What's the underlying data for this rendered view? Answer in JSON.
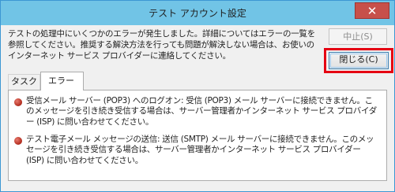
{
  "window": {
    "title": "テスト アカウント設定",
    "close_glyph": "✕"
  },
  "message": "テストの処理中にいくつかのエラーが発生しました。詳細についてはエラーの一覧を参照してください。推奨する解決方法を行っても問題が解決しない場合は、お使いのインターネット サービス プロバイダーに連絡してください。",
  "buttons": {
    "stop_label": "中止(S)",
    "close_label": "閉じる(C)"
  },
  "tabs": [
    {
      "label": "タスク",
      "selected": false
    },
    {
      "label": "エラー",
      "selected": true
    }
  ],
  "errors": [
    {
      "icon": "error-icon",
      "text": "受信メール サーバー (POP3) へのログオン: 受信 (POP3) メール サーバーに接続できません。このメッセージを引き続き受信する場合は、サーバー管理者かインターネット サービス プロバイダー (ISP) に問い合わせてください。"
    },
    {
      "icon": "error-icon",
      "text": "テスト電子メール メッセージの送信: 送信 (SMTP) メール サーバーに接続できません。このメッセージを引き続き受信する場合は、サーバー管理者かインターネット サービス プロバイダー (ISP) に問い合わせてください。"
    }
  ],
  "colors": {
    "titlebar": "#71c4e6",
    "highlight": "#e50012",
    "error_icon": "#b02a1c"
  }
}
